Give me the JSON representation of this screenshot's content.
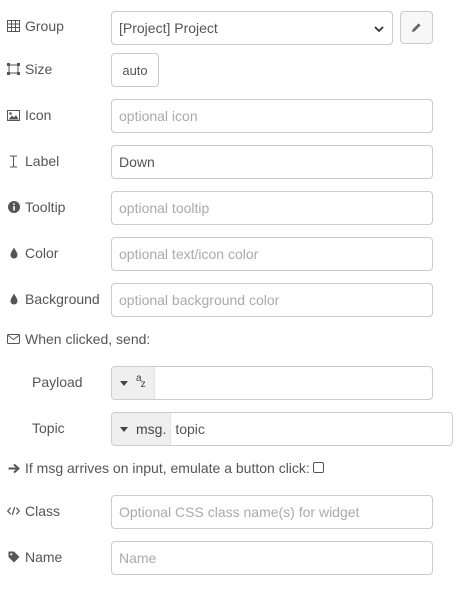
{
  "group": {
    "label": "Group",
    "value": "[Project] Project"
  },
  "size": {
    "label": "Size",
    "value": "auto"
  },
  "icon": {
    "label": "Icon",
    "placeholder": "optional icon"
  },
  "label_field": {
    "label": "Label",
    "value": "Down"
  },
  "tooltip": {
    "label": "Tooltip",
    "placeholder": "optional tooltip"
  },
  "color": {
    "label": "Color",
    "placeholder": "optional text/icon color"
  },
  "background": {
    "label": "Background",
    "placeholder": "optional background color"
  },
  "when_clicked": {
    "label": "When clicked, send:"
  },
  "payload": {
    "label": "Payload",
    "type_badge": "az"
  },
  "topic": {
    "label": "Topic",
    "type_badge": "msg.",
    "value": "topic"
  },
  "emulate": {
    "label": "If msg arrives on input, emulate a button click:",
    "checked": false
  },
  "class_field": {
    "label": "Class",
    "placeholder": "Optional CSS class name(s) for widget"
  },
  "name_field": {
    "label": "Name",
    "placeholder": "Name"
  }
}
